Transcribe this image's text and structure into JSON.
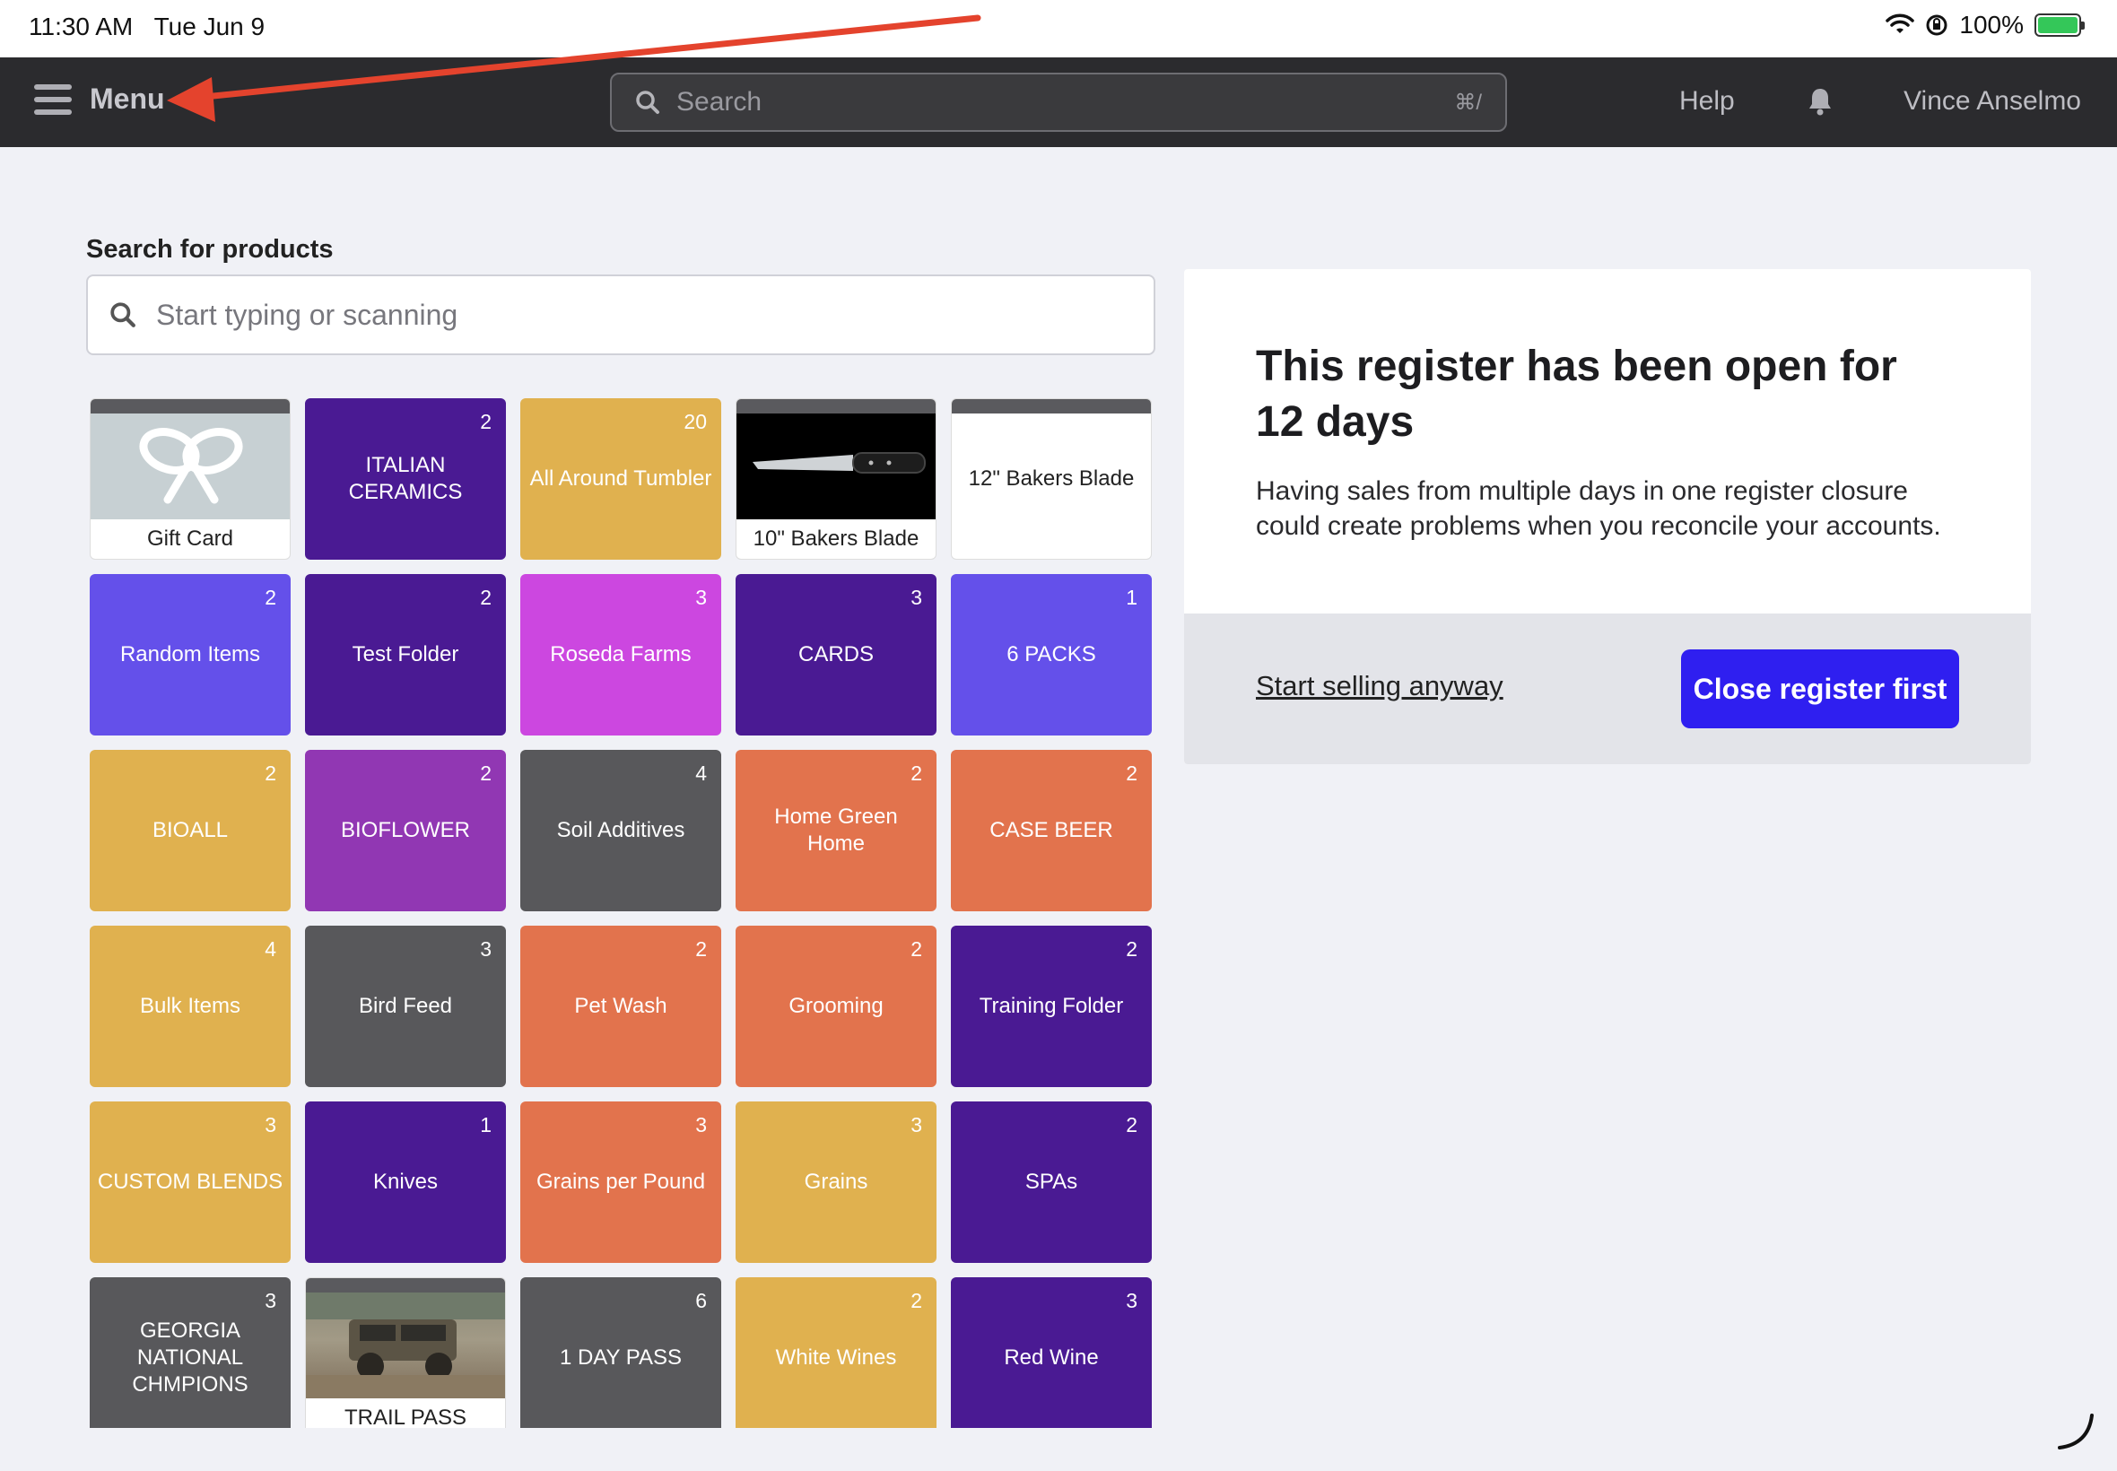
{
  "status_bar": {
    "time": "11:30 AM",
    "date": "Tue Jun 9",
    "battery": "100%",
    "icons": [
      "wifi-icon",
      "rotation-lock-icon",
      "battery-charging-icon"
    ]
  },
  "nav": {
    "menu_label": "Menu",
    "search_placeholder": "Search",
    "search_shortcut": "⌘/",
    "help_label": "Help",
    "user_name": "Vince Anselmo"
  },
  "products": {
    "search_label": "Search for products",
    "search_placeholder": "Start typing or scanning"
  },
  "tiles": [
    {
      "label": "Gift Card",
      "count": "",
      "kind": "gift",
      "color": "#ffffff"
    },
    {
      "label": "ITALIAN CERAMICS",
      "count": "2",
      "kind": "color",
      "color": "#4a1a93"
    },
    {
      "label": "All Around Tumbler",
      "count": "20",
      "kind": "color",
      "color": "#e0b14f"
    },
    {
      "label": "10\" Bakers Blade",
      "count": "",
      "kind": "knife",
      "color": "#ffffff"
    },
    {
      "label": "12\" Bakers Blade",
      "count": "",
      "kind": "plain",
      "color": "#ffffff"
    },
    {
      "label": "Random Items",
      "count": "2",
      "kind": "color",
      "color": "#6450ea"
    },
    {
      "label": "Test Folder",
      "count": "2",
      "kind": "color",
      "color": "#4a1a93"
    },
    {
      "label": "Roseda Farms",
      "count": "3",
      "kind": "color",
      "color": "#cc47e0"
    },
    {
      "label": "CARDS",
      "count": "3",
      "kind": "color",
      "color": "#4a1a93"
    },
    {
      "label": "6 PACKS",
      "count": "1",
      "kind": "color",
      "color": "#6450ea"
    },
    {
      "label": "BIOALL",
      "count": "2",
      "kind": "color",
      "color": "#e0b14f"
    },
    {
      "label": "BIOFLOWER",
      "count": "2",
      "kind": "color",
      "color": "#9137b3"
    },
    {
      "label": "Soil Additives",
      "count": "4",
      "kind": "color",
      "color": "#58585b"
    },
    {
      "label": "Home Green Home",
      "count": "2",
      "kind": "color",
      "color": "#e2734d"
    },
    {
      "label": "CASE BEER",
      "count": "2",
      "kind": "color",
      "color": "#e2734d"
    },
    {
      "label": "Bulk Items",
      "count": "4",
      "kind": "color",
      "color": "#e0b14f"
    },
    {
      "label": "Bird Feed",
      "count": "3",
      "kind": "color",
      "color": "#58585b"
    },
    {
      "label": "Pet Wash",
      "count": "2",
      "kind": "color",
      "color": "#e2734d"
    },
    {
      "label": "Grooming",
      "count": "2",
      "kind": "color",
      "color": "#e2734d"
    },
    {
      "label": "Training Folder",
      "count": "2",
      "kind": "color",
      "color": "#4a1a93"
    },
    {
      "label": "CUSTOM BLENDS",
      "count": "3",
      "kind": "color",
      "color": "#e0b14f"
    },
    {
      "label": "Knives",
      "count": "1",
      "kind": "color",
      "color": "#4a1a93"
    },
    {
      "label": "Grains per Pound",
      "count": "3",
      "kind": "color",
      "color": "#e2734d"
    },
    {
      "label": "Grains",
      "count": "3",
      "kind": "color",
      "color": "#e0b14f"
    },
    {
      "label": "SPAs",
      "count": "2",
      "kind": "color",
      "color": "#4a1a93"
    },
    {
      "label": "GEORGIA NATIONAL CHMPIONS",
      "count": "3",
      "kind": "color",
      "color": "#58585b"
    },
    {
      "label": "TRAIL PASS",
      "count": "",
      "kind": "jeep",
      "color": "#ffffff"
    },
    {
      "label": "1 DAY PASS",
      "count": "6",
      "kind": "color",
      "color": "#58585b"
    },
    {
      "label": "White Wines",
      "count": "2",
      "kind": "color",
      "color": "#e0b14f"
    },
    {
      "label": "Red Wine",
      "count": "3",
      "kind": "color",
      "color": "#4a1a93"
    }
  ],
  "dialog": {
    "title": "This register has been open for 12 days",
    "body": "Having sales from multiple days in one register closure could create problems when you reconcile your accounts.",
    "secondary_action": "Start selling anyway",
    "primary_action": "Close register first"
  },
  "colors": {
    "accent": "#2f1ff0",
    "nav_bg": "#2b2b2e",
    "annotation_arrow": "#e4432d"
  }
}
